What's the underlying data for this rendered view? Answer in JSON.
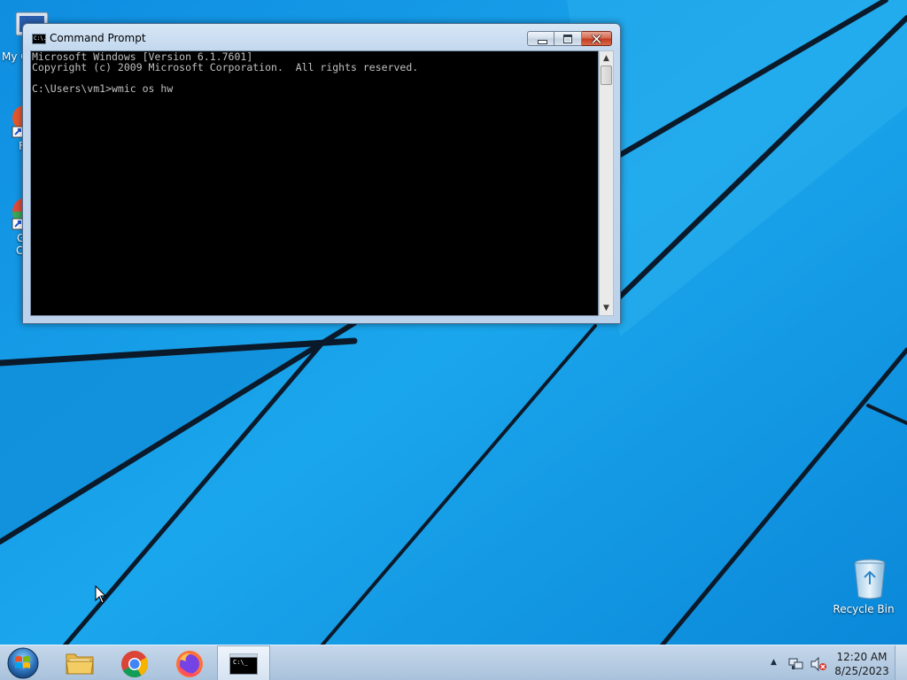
{
  "desktop": {
    "icons": [
      {
        "label": "My C"
      },
      {
        "label": "F"
      },
      {
        "label": "G"
      },
      {
        "label": "C"
      },
      {
        "label": "Recycle Bin"
      }
    ]
  },
  "window": {
    "title": "Command Prompt",
    "icon_text": "C:\\.",
    "console_lines": [
      "Microsoft Windows [Version 6.1.7601]",
      "Copyright (c) 2009 Microsoft Corporation.  All rights reserved.",
      "",
      "C:\\Users\\vm1>wmic os hw"
    ]
  },
  "taskbar": {
    "items": [
      {
        "name": "file-explorer",
        "icon": "folder-icon"
      },
      {
        "name": "chrome",
        "icon": "chrome-icon"
      },
      {
        "name": "firefox",
        "icon": "firefox-icon"
      },
      {
        "name": "command-prompt",
        "icon": "cmd-icon",
        "active": true
      }
    ],
    "cmd_icon_text": "C:\\_",
    "clock": {
      "time": "12:20 AM",
      "date": "8/25/2023"
    }
  },
  "colors": {
    "wallpaper": "#1aa0e8",
    "console_bg": "#000000",
    "console_fg": "#c0c0c0",
    "close_button": "#c2391d"
  }
}
